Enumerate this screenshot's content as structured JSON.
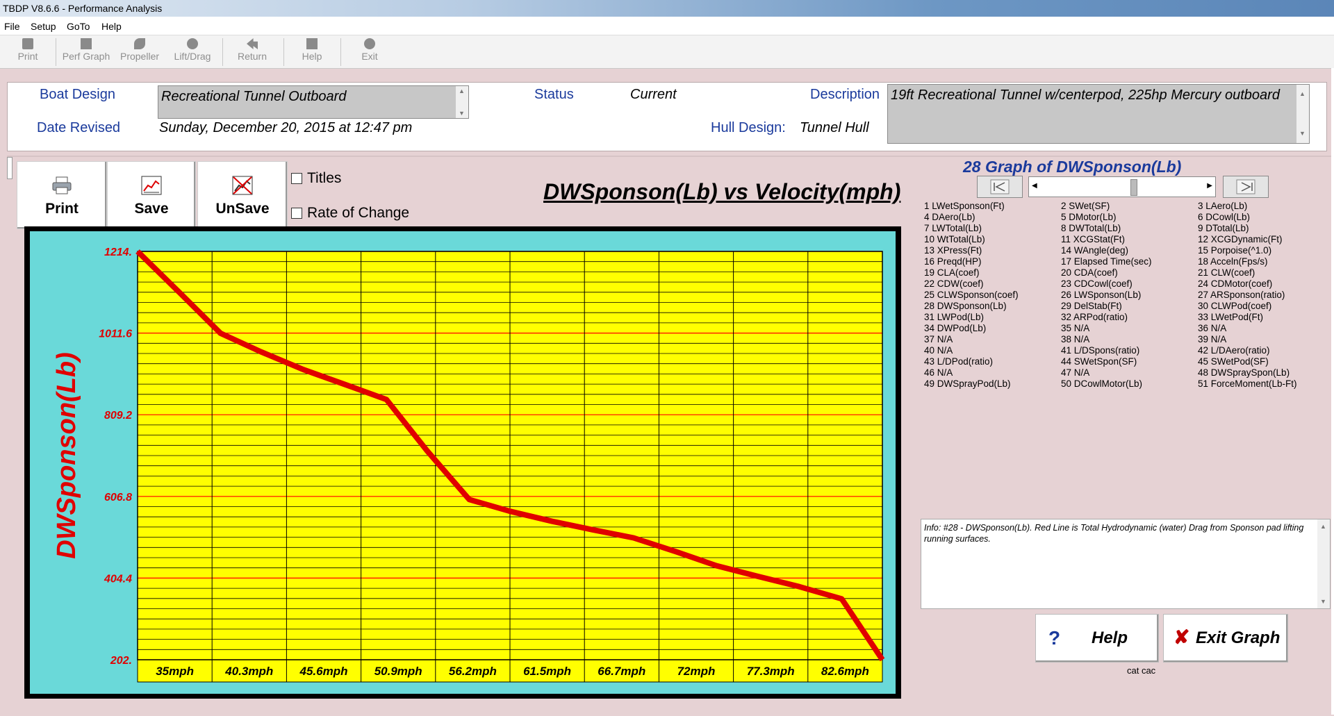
{
  "window": {
    "title": "TBDP V8.6.6 - Performance Analysis"
  },
  "menu": [
    "File",
    "Setup",
    "GoTo",
    "Help"
  ],
  "toolbar": {
    "print": "Print",
    "perf_graph": "Perf Graph",
    "propeller": "Propeller",
    "lift_drag": "Lift/Drag",
    "return": "Return",
    "help": "Help",
    "exit": "Exit"
  },
  "header": {
    "boat_design_label": "Boat Design",
    "boat_design_value": "Recreational Tunnel Outboard",
    "status_label": "Status",
    "status_value": "Current",
    "description_label": "Description",
    "description_value": "19ft Recreational Tunnel w/centerpod, 225hp Mercury outboard",
    "date_revised_label": "Date Revised",
    "date_revised_value": "Sunday, December 20, 2015 at 12:47 pm",
    "hull_design_label": "Hull Design:",
    "hull_design_value": "Tunnel Hull"
  },
  "graph_controls": {
    "print": "Print",
    "save": "Save",
    "unsave": "UnSave",
    "titles": "Titles",
    "rate_of_change": "Rate of Change"
  },
  "colors": {
    "plot_bg": "#ffff00",
    "frame_bg": "#6ad9d9",
    "line": "#e00000",
    "grid_major": "#ff0000",
    "grid_minor": "#000000",
    "label_red": "#e00000"
  },
  "chart_data": {
    "type": "line",
    "title": "DWSponson(Lb) vs Velocity(mph)",
    "ylabel": "DWSponson(Lb)",
    "xlabel": "",
    "categories": [
      "35mph",
      "40.3mph",
      "45.6mph",
      "50.9mph",
      "56.2mph",
      "61.5mph",
      "66.7mph",
      "72mph",
      "77.3mph",
      "82.6mph"
    ],
    "y_ticks": [
      "1214.",
      "1011.6",
      "809.2",
      "606.8",
      "404.4",
      "202."
    ],
    "ylim": [
      202,
      1214
    ],
    "x": [
      35,
      37.6,
      40.3,
      42.9,
      45.6,
      48.2,
      50.9,
      53.5,
      56.2,
      58.8,
      61.5,
      64.1,
      66.7,
      69.4,
      72,
      74.7,
      77.3,
      80.0,
      82.6
    ],
    "values": [
      1214,
      1115,
      1011,
      965,
      921,
      885,
      847,
      720,
      599,
      570,
      545,
      524,
      504,
      470,
      435,
      408,
      383,
      353,
      202
    ],
    "grid": true
  },
  "side_panel": {
    "graph_title": "28 Graph of DWSponson(Lb)",
    "columns": [
      [
        "1 LWetSponson(Ft)",
        "4 DAero(Lb)",
        "7 LWTotal(Lb)",
        "10 WtTotal(Lb)",
        "13 XPress(Ft)",
        "16 Preqd(HP)",
        "19 CLA(coef)",
        "22 CDW(coef)",
        "25 CLWSponson(coef)",
        "28 DWSponson(Lb)",
        "31 LWPod(Lb)",
        "34 DWPod(Lb)",
        "37 N/A",
        "40 N/A",
        "43 L/DPod(ratio)",
        "46 N/A",
        "49 DWSprayPod(Lb)"
      ],
      [
        "2 SWet(SF)",
        "5 DMotor(Lb)",
        "8 DWTotal(Lb)",
        "11 XCGStat(Ft)",
        "14 WAngle(deg)",
        "17 Elapsed Time(sec)",
        "20 CDA(coef)",
        "23 CDCowl(coef)",
        "26 LWSponson(Lb)",
        "29 DelStab(Ft)",
        "32 ARPod(ratio)",
        "35 N/A",
        "38 N/A",
        "41 L/DSpons(ratio)",
        "44 SWetSpon(SF)",
        "47 N/A",
        "50 DCowlMotor(Lb)"
      ],
      [
        "3 LAero(Lb)",
        "6 DCowl(Lb)",
        "9 DTotal(Lb)",
        "12 XCGDynamic(Ft)",
        "15 Porpoise(^1.0)",
        "18 Acceln(Fps/s)",
        "21 CLW(coef)",
        "24 CDMotor(coef)",
        "27 ARSponson(ratio)",
        "30 CLWPod(coef)",
        "33 LWetPod(Ft)",
        "36 N/A",
        "39 N/A",
        "42 L/DAero(ratio)",
        "45 SWetPod(SF)",
        "48 DWSpraySpon(Lb)",
        "51 ForceMoment(Lb-Ft)"
      ]
    ],
    "info": "Info: #28 - DWSponson(Lb). Red Line is Total Hydrodynamic (water) Drag from Sponson pad lifting running surfaces.",
    "help_button": "Help",
    "exit_button": "Exit Graph",
    "footer_text": "cat cac"
  }
}
